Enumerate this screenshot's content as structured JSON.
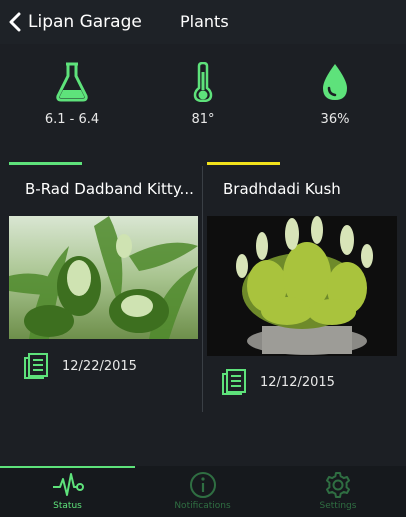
{
  "header": {
    "back_label": "Lipan Garage",
    "title": "Plants"
  },
  "stats": [
    {
      "icon": "flask-icon",
      "value": "6.1 - 6.4"
    },
    {
      "icon": "thermometer-icon",
      "value": "81°"
    },
    {
      "icon": "water-drop-icon",
      "value": "36%"
    }
  ],
  "plants": [
    {
      "name": "B-Rad Dadband Kitty...",
      "date": "12/22/2015",
      "accent": "#5ee27b"
    },
    {
      "name": "Bradhdadi Kush",
      "date": "12/12/2015",
      "accent": "#f2e21c"
    }
  ],
  "tabs": [
    {
      "label": "Status",
      "icon": "pulse-icon",
      "active": true
    },
    {
      "label": "Notifications",
      "icon": "info-icon",
      "active": false
    },
    {
      "label": "Settings",
      "icon": "gear-icon",
      "active": false
    }
  ],
  "colors": {
    "accent_green": "#5ee27b",
    "accent_yellow": "#f2e21c",
    "background": "#1c1f24",
    "inactive_tab": "#2f6e42"
  }
}
